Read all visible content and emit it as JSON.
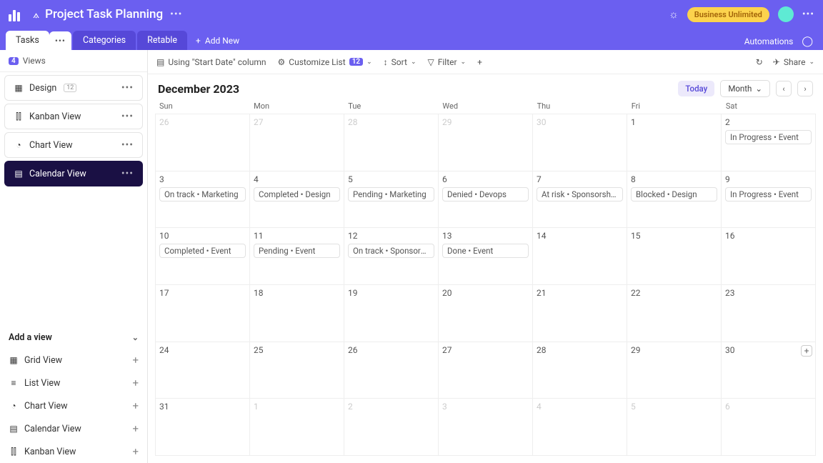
{
  "header": {
    "title": "Project Task Planning",
    "plan_badge": "Business Unlimited"
  },
  "tabs": {
    "items": [
      "Tasks",
      "Categories",
      "Retable"
    ],
    "add_new": "Add New",
    "automations": "Automations"
  },
  "sidebar": {
    "views_label": "Views",
    "views_count": "4",
    "views": [
      {
        "label": "Design",
        "icon": "grid",
        "pill": "12"
      },
      {
        "label": "Kanban View",
        "icon": "kanban"
      },
      {
        "label": "Chart View",
        "icon": "chart"
      },
      {
        "label": "Calendar View",
        "icon": "calendar",
        "active": true
      }
    ],
    "add_view_label": "Add a view",
    "add_views": [
      {
        "label": "Grid View",
        "icon": "grid"
      },
      {
        "label": "List View",
        "icon": "list"
      },
      {
        "label": "Chart View",
        "icon": "chart"
      },
      {
        "label": "Calendar View",
        "icon": "calendar"
      },
      {
        "label": "Kanban View",
        "icon": "kanban"
      }
    ]
  },
  "toolbar": {
    "using_column": "Using \"Start Date\" column",
    "customize": "Customize List",
    "customize_count": "12",
    "sort": "Sort",
    "filter": "Filter",
    "share": "Share"
  },
  "calendar": {
    "month_label": "December 2023",
    "today": "Today",
    "period": "Month",
    "dow": [
      "Sun",
      "Mon",
      "Tue",
      "Wed",
      "Thu",
      "Fri",
      "Sat"
    ],
    "weeks": [
      [
        {
          "n": "26",
          "other": true
        },
        {
          "n": "27",
          "other": true
        },
        {
          "n": "28",
          "other": true
        },
        {
          "n": "29",
          "other": true
        },
        {
          "n": "30",
          "other": true
        },
        {
          "n": "1"
        },
        {
          "n": "2",
          "events": [
            "In Progress • Event"
          ]
        }
      ],
      [
        {
          "n": "3",
          "events": [
            "On track • Marketing"
          ]
        },
        {
          "n": "4",
          "events": [
            "Completed • Design"
          ]
        },
        {
          "n": "5",
          "events": [
            "Pending • Marketing"
          ]
        },
        {
          "n": "6",
          "events": [
            "Denied • Devops"
          ]
        },
        {
          "n": "7",
          "events": [
            "At risk • Sponsorships"
          ]
        },
        {
          "n": "8",
          "events": [
            "Blocked • Design"
          ]
        },
        {
          "n": "9",
          "events": [
            "In Progress • Event"
          ]
        }
      ],
      [
        {
          "n": "10",
          "events": [
            "Completed • Event"
          ]
        },
        {
          "n": "11",
          "events": [
            "Pending • Event"
          ]
        },
        {
          "n": "12",
          "events": [
            "On track • Sponsorship…"
          ]
        },
        {
          "n": "13",
          "events": [
            "Done • Event"
          ]
        },
        {
          "n": "14"
        },
        {
          "n": "15"
        },
        {
          "n": "16"
        }
      ],
      [
        {
          "n": "17"
        },
        {
          "n": "18"
        },
        {
          "n": "19"
        },
        {
          "n": "20"
        },
        {
          "n": "21"
        },
        {
          "n": "22"
        },
        {
          "n": "23"
        }
      ],
      [
        {
          "n": "24"
        },
        {
          "n": "25"
        },
        {
          "n": "26"
        },
        {
          "n": "27"
        },
        {
          "n": "28"
        },
        {
          "n": "29"
        },
        {
          "n": "30",
          "add": true
        }
      ],
      [
        {
          "n": "31"
        },
        {
          "n": "1",
          "other": true
        },
        {
          "n": "2",
          "other": true
        },
        {
          "n": "3",
          "other": true
        },
        {
          "n": "4",
          "other": true
        },
        {
          "n": "5",
          "other": true
        },
        {
          "n": "6",
          "other": true
        }
      ]
    ]
  },
  "icons": {
    "grid": "▦",
    "kanban": "⫿⫿",
    "chart": "◔",
    "calendar": "▤",
    "list": "≡"
  }
}
